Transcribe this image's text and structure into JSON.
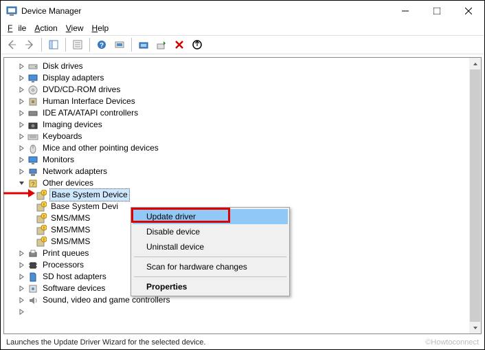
{
  "window": {
    "title": "Device Manager"
  },
  "menu": {
    "file": "File",
    "action": "Action",
    "view": "View",
    "help": "Help"
  },
  "tree": {
    "items": [
      {
        "label": "Disk drives",
        "icon": "disk"
      },
      {
        "label": "Display adapters",
        "icon": "display"
      },
      {
        "label": "DVD/CD-ROM drives",
        "icon": "dvd"
      },
      {
        "label": "Human Interface Devices",
        "icon": "hid"
      },
      {
        "label": "IDE ATA/ATAPI controllers",
        "icon": "ide"
      },
      {
        "label": "Imaging devices",
        "icon": "imaging"
      },
      {
        "label": "Keyboards",
        "icon": "keyboard"
      },
      {
        "label": "Mice and other pointing devices",
        "icon": "mouse"
      },
      {
        "label": "Monitors",
        "icon": "monitor"
      },
      {
        "label": "Network adapters",
        "icon": "network"
      }
    ],
    "other": {
      "label": "Other devices",
      "children": [
        {
          "label": "Base System Device",
          "selected": true
        },
        {
          "label": "Base System Devi"
        },
        {
          "label": "SMS/MMS"
        },
        {
          "label": "SMS/MMS"
        },
        {
          "label": "SMS/MMS"
        }
      ]
    },
    "after": [
      {
        "label": "Print queues",
        "icon": "print"
      },
      {
        "label": "Processors",
        "icon": "cpu"
      },
      {
        "label": "SD host adapters",
        "icon": "sd"
      },
      {
        "label": "Software devices",
        "icon": "soft"
      },
      {
        "label": "Sound, video and game controllers",
        "icon": "sound"
      }
    ]
  },
  "context_menu": {
    "update": "Update driver",
    "disable": "Disable device",
    "uninstall": "Uninstall device",
    "scan": "Scan for hardware changes",
    "properties": "Properties"
  },
  "status": {
    "text": "Launches the Update Driver Wizard for the selected device."
  },
  "watermark": "©Howtoconnect"
}
